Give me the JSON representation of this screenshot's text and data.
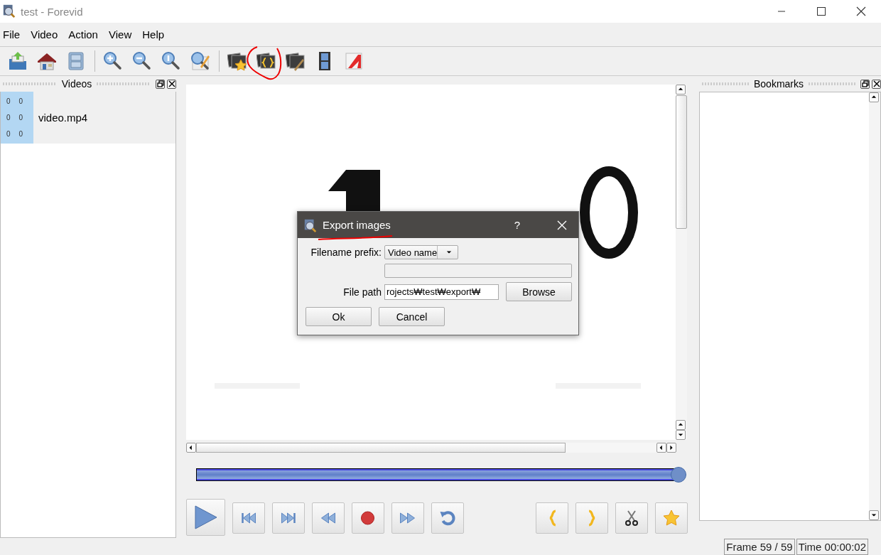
{
  "window": {
    "title": "test - Forevid"
  },
  "menu": [
    "File",
    "Video",
    "Action",
    "View",
    "Help"
  ],
  "videos_panel": {
    "title": "Videos",
    "items": [
      {
        "name": "video.mp4",
        "counters": [
          [
            "0",
            "0"
          ],
          [
            "0",
            "0"
          ],
          [
            "0",
            "0"
          ]
        ]
      }
    ]
  },
  "player": {
    "position": {
      "level": 1
    }
  },
  "bookmarks_panel": {
    "title": "Bookmarks"
  },
  "dialog": {
    "title": "Export images",
    "help": "?",
    "prefix_label": "Filename prefix:",
    "prefix_value": "Video name",
    "path_label": "File path",
    "path_value": "rojects₩test₩export₩",
    "browse": "Browse",
    "ok": "Ok",
    "cancel": "Cancel"
  },
  "status_bar": {
    "frame": "Frame 59 / 59",
    "time": "Time 00:00:02"
  }
}
